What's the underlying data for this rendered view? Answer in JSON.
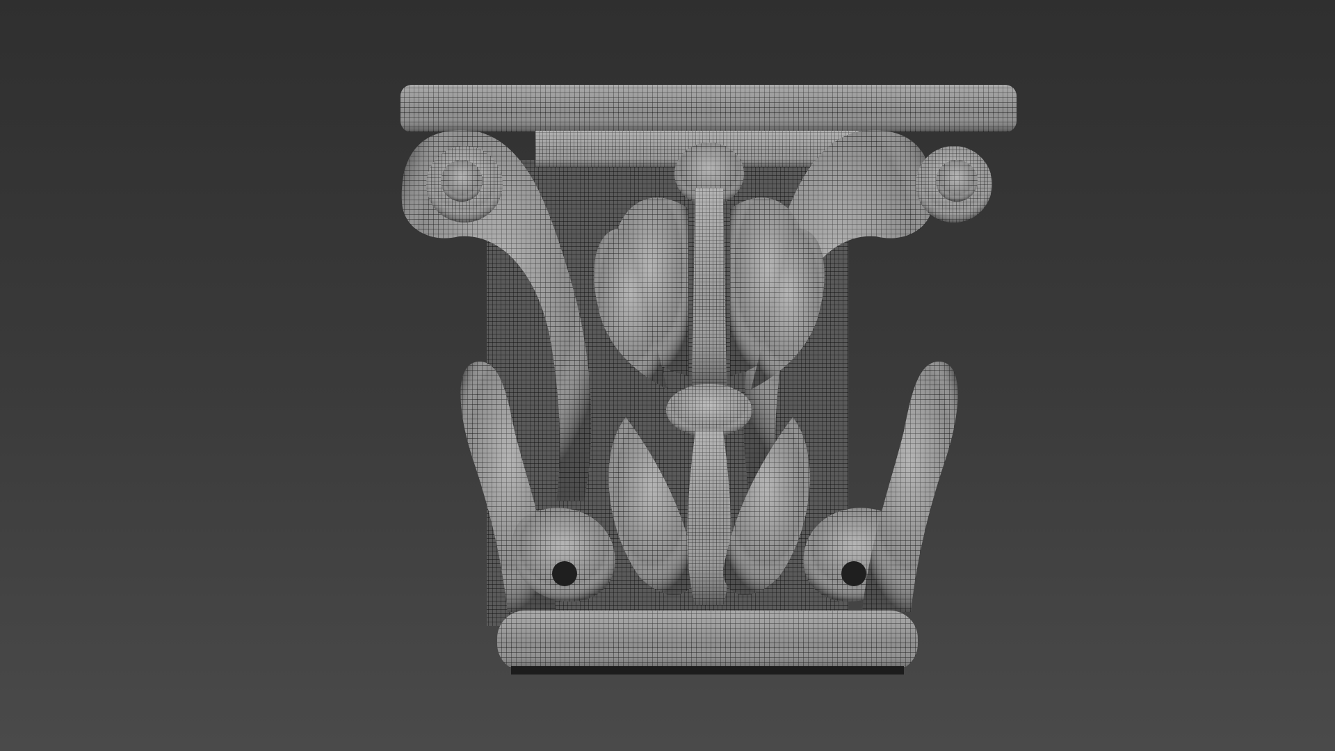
{
  "viewport": {
    "background_top": "#2f2f2f",
    "background_bottom": "#4a4a4a"
  },
  "model": {
    "subject": "corinthian-capital-wireframe",
    "surface_color": "#8a8a8a",
    "wire_color": "#1a1a1a",
    "highlight_color": "#cfcfcf"
  }
}
